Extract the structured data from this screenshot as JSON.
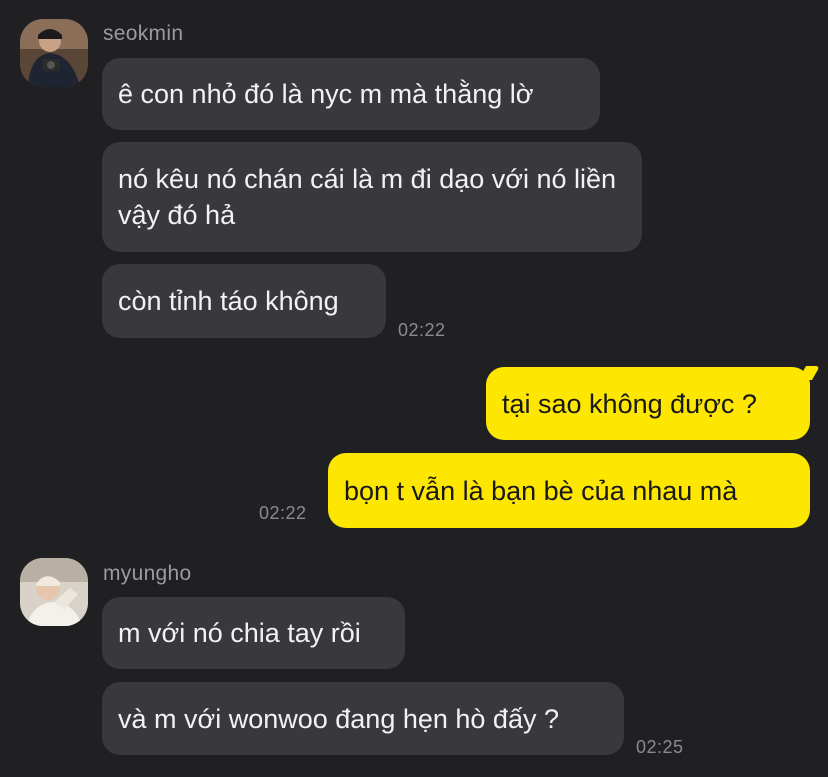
{
  "messages": {
    "seokmin": {
      "name": "seokmin",
      "lines": [
        "ê con nhỏ đó là nyc m mà thằng lờ",
        "nó kêu nó chán cái là m đi dạo với nó liền vậy đó hả",
        "còn tỉnh táo không"
      ],
      "time": "02:22"
    },
    "me": {
      "lines": [
        "tại sao không được ?",
        "bọn t vẫn là bạn bè của nhau mà"
      ],
      "time": "02:22"
    },
    "myungho": {
      "name": "myungho",
      "lines": [
        "m với nó chia tay rồi",
        "và m với wonwoo đang hẹn hò đấy ?"
      ],
      "time": "02:25"
    }
  },
  "colors": {
    "background": "#202023",
    "incoming_bubble": "#39393d",
    "outgoing_bubble": "#fde700"
  }
}
